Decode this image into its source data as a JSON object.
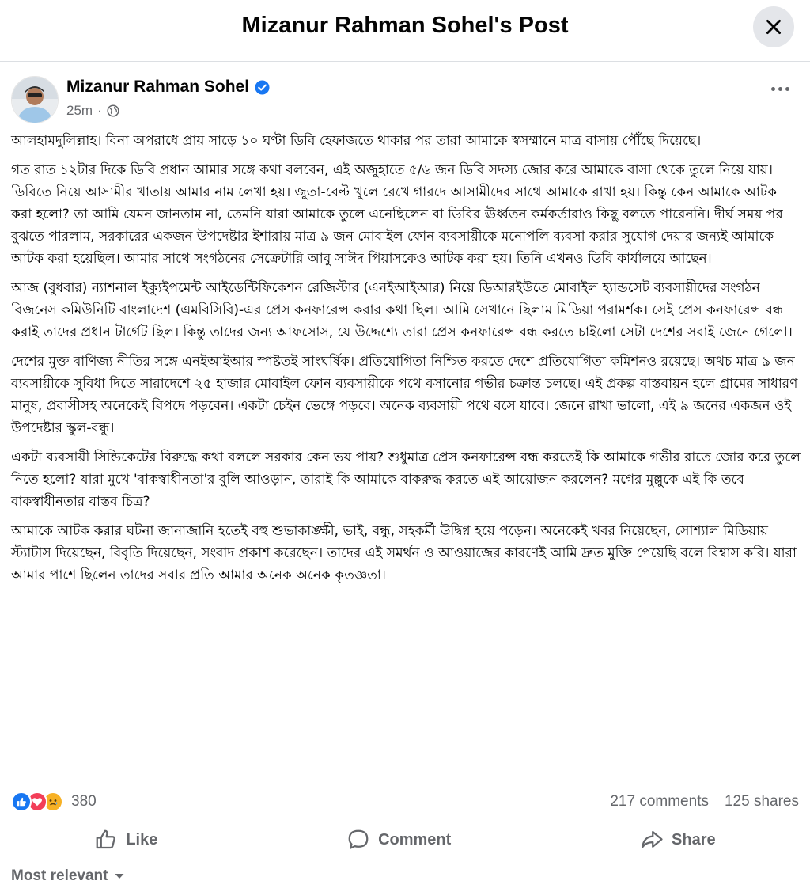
{
  "header": {
    "title": "Mizanur Rahman Sohel's Post",
    "close_icon": "close-icon"
  },
  "post": {
    "author": "Mizanur Rahman Sohel",
    "verified": true,
    "time": "25m",
    "audience_icon": "globe-icon",
    "more_icon": "more-horizontal-icon",
    "paragraphs": [
      "আলহামদুলিল্লাহ। বিনা অপরাধে প্রায় সাড়ে ১০ ঘণ্টা ডিবি হেফাজতে থাকার পর তারা আমাকে স্বসম্মানে মাত্র বাসায় পৌঁছে দিয়েছে।",
      "গত রাত ১২টার দিকে ডিবি প্রধান আমার সঙ্গে কথা বলবেন, এই অজুহাতে ৫/৬ জন ডিবি সদস্য জোর করে আমাকে বাসা থেকে তুলে নিয়ে যায়। ডিবিতে নিয়ে আসামীর খাতায় আমার নাম লেখা হয়। জুতা-বেল্ট খুলে রেখে গারদে আসামীদের সাথে আমাকে রাখা হয়। কিন্তু কেন আমাকে আটক করা হলো? তা আমি যেমন জানতাম না, তেমনি যারা আমাকে তুলে এনেছিলেন বা ডিবির ঊর্ধ্বতন কর্মকর্তারাও কিছু বলতে পারেননি। দীর্ঘ সময় পর বুঝতে পারলাম, সরকারের একজন উপদেষ্টার ইশারায় মাত্র ৯ জন মোবাইল ফোন ব্যবসায়ীকে মনোপলি ব্যবসা করার সুযোগ দেয়ার জন্যই আমাকে আটক করা হয়েছিল। আমার সাথে সংগঠনের সেক্রেটারি আবু সাঈদ পিয়াসকেও আটক করা হয়। তিনি এখনও ডিবি কার্যালয়ে আছেন।",
      "আজ (বুধবার) ন্যাশনাল ইক্যুইপমেন্ট আইডেন্টিফিকেশন রেজিস্টার (এনইআইআর) নিয়ে ডিআরইউতে মোবাইল হ্যান্ডসেট ব্যবসায়ীদের সংগঠন বিজনেস কমিউনিটি বাংলাদেশ (এমবিসিবি)-এর প্রেস কনফারেন্স করার কথা ছিল। আমি সেখানে ছিলাম মিডিয়া পরামর্শক। সেই প্রেস কনফারেন্স বন্ধ করাই তাদের প্রধান টার্গেট ছিল। কিন্তু তাদের জন্য আফসোস, যে উদ্দেশ্যে তারা প্রেস কনফারেন্স বন্ধ করতে চাইলো সেটা দেশের সবাই জেনে গেলো।",
      "দেশের মুক্ত বাণিজ্য নীতির সঙ্গে এনইআইআর স্পষ্টতই সাংঘর্ষিক। প্রতিযোগিতা নিশ্চিত করতে দেশে প্রতিযোগিতা কমিশনও রয়েছে। অথচ মাত্র ৯ জন ব্যবসায়ীকে সুবিধা দিতে সারাদেশে ২৫ হাজার মোবাইল ফোন ব্যবসায়ীকে পথে বসানোর গভীর চক্রান্ত চলছে। এই প্রকল্প বাস্তবায়ন হলে গ্রামের সাধারণ মানুষ, প্রবাসীসহ অনেকেই বিপদে পড়বেন। একটা চেইন ভেঙ্গে পড়বে। অনেক ব্যবসায়ী পথে বসে যাবে। জেনে রাখা ভালো, এই ৯ জনের একজন ওই উপদেষ্টার স্কুল-বন্ধু।",
      "একটা ব্যবসায়ী সিন্ডিকেটের বিরুদ্ধে কথা বললে সরকার কেন ভয় পায়? শুধুমাত্র প্রেস কনফারেন্স বন্ধ করতেই কি আমাকে গভীর রাতে জোর করে তুলে নিতে হলো? যারা মুখে 'বাকস্বাধীনতা'র বুলি আওড়ান, তারাই কি আমাকে বাকরুদ্ধ করতে এই আয়োজন করলেন? মগের মুল্লুকে এই কি তবে বাকস্বাধীনতার বাস্তব চিত্র?",
      "আমাকে আটক করার ঘটনা জানাজানি হতেই বহু শুভাকাঙ্ক্ষী, ভাই, বন্ধু, সহকর্মী উদ্বিগ্ন হয়ে পড়েন। অনেকেই খবর নিয়েছেন, সোশ্যাল মিডিয়ায় স্ট্যাটাস দিয়েছেন, বিবৃতি দিয়েছেন, সংবাদ প্রকাশ করেছেন। তাদের এই সমর্থন ও আওয়াজের কারণেই আমি দ্রুত মুক্তি পেয়েছি বলে বিশ্বাস করি। যারা আমার পাশে ছিলেন তাদের সবার প্রতি আমার অনেক অনেক কৃতজ্ঞতা।"
    ]
  },
  "stats": {
    "reaction_icons": [
      "like-icon",
      "love-icon",
      "sad-icon"
    ],
    "reaction_count": "380",
    "comments": "217 comments",
    "shares": "125 shares"
  },
  "actions": {
    "like": "Like",
    "comment": "Comment",
    "share": "Share"
  },
  "comments_sort": {
    "label": "Most relevant"
  },
  "colors": {
    "accent": "#1877f2",
    "love": "#f33e58",
    "sad": "#f7b125",
    "muted_text": "#65676b"
  }
}
